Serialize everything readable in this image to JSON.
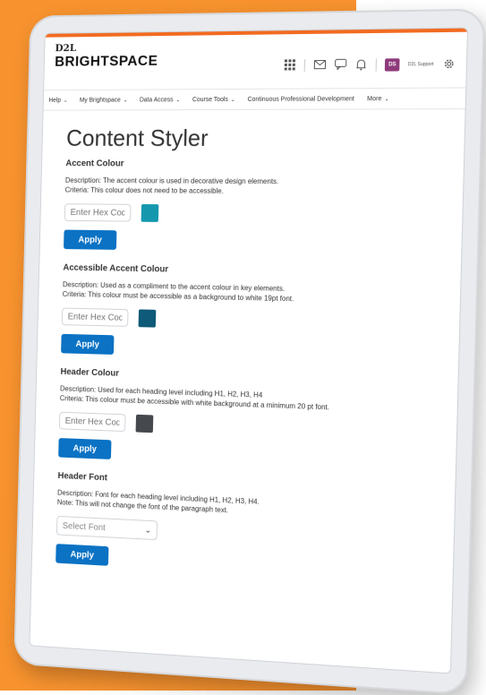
{
  "colors": {
    "background_orange": "#f7922e",
    "top_accent": "#f26b21",
    "primary_button": "#0b72c4",
    "avatar_bg": "#8e3a7b"
  },
  "brand": {
    "line1": "D2L",
    "line2": "BRIGHTSPACE"
  },
  "header": {
    "icons": [
      "grid-icon",
      "mail-icon",
      "chat-icon",
      "bell-icon"
    ],
    "avatar_initials": "DS",
    "user_label": "D2L Support",
    "settings_icon": "gear-icon"
  },
  "nav": {
    "items": [
      {
        "label": "Help",
        "has_caret": true
      },
      {
        "label": "My Brightspace",
        "has_caret": true
      },
      {
        "label": "Data Access",
        "has_caret": true
      },
      {
        "label": "Course Tools",
        "has_caret": true
      },
      {
        "label": "Continuous Professional Development",
        "has_caret": false
      },
      {
        "label": "More",
        "has_caret": true
      }
    ]
  },
  "page": {
    "title": "Content Styler"
  },
  "sections": {
    "accent": {
      "heading": "Accent Colour",
      "description": "Description: The accent colour is used in decorative design elements.",
      "criteria": "Criteria: This colour does not need to be accessible.",
      "placeholder": "Enter Hex Code",
      "swatch": "#1598ae",
      "button": "Apply"
    },
    "accessible_accent": {
      "heading": "Accessible Accent Colour",
      "description": "Description: Used as a compliment to the accent colour in key elements.",
      "criteria": "Criteria: This colour must be accessible as a background to white 19pt font.",
      "placeholder": "Enter Hex Code",
      "swatch": "#0e5a78",
      "button": "Apply"
    },
    "header_colour": {
      "heading": "Header Colour",
      "description": "Description: Used for each heading level including H1, H2, H3, H4",
      "criteria": "Criteria: This colour must be accessible with white background at a minimum 20 pt font.",
      "placeholder": "Enter Hex Code",
      "swatch": "#45494e",
      "button": "Apply"
    },
    "header_font": {
      "heading": "Header Font",
      "description": "Description: Font for each heading level including H1, H2, H3, H4.",
      "note": "Note: This will not change the font of the paragraph text.",
      "select_value": "Select Font",
      "button": "Apply"
    }
  }
}
